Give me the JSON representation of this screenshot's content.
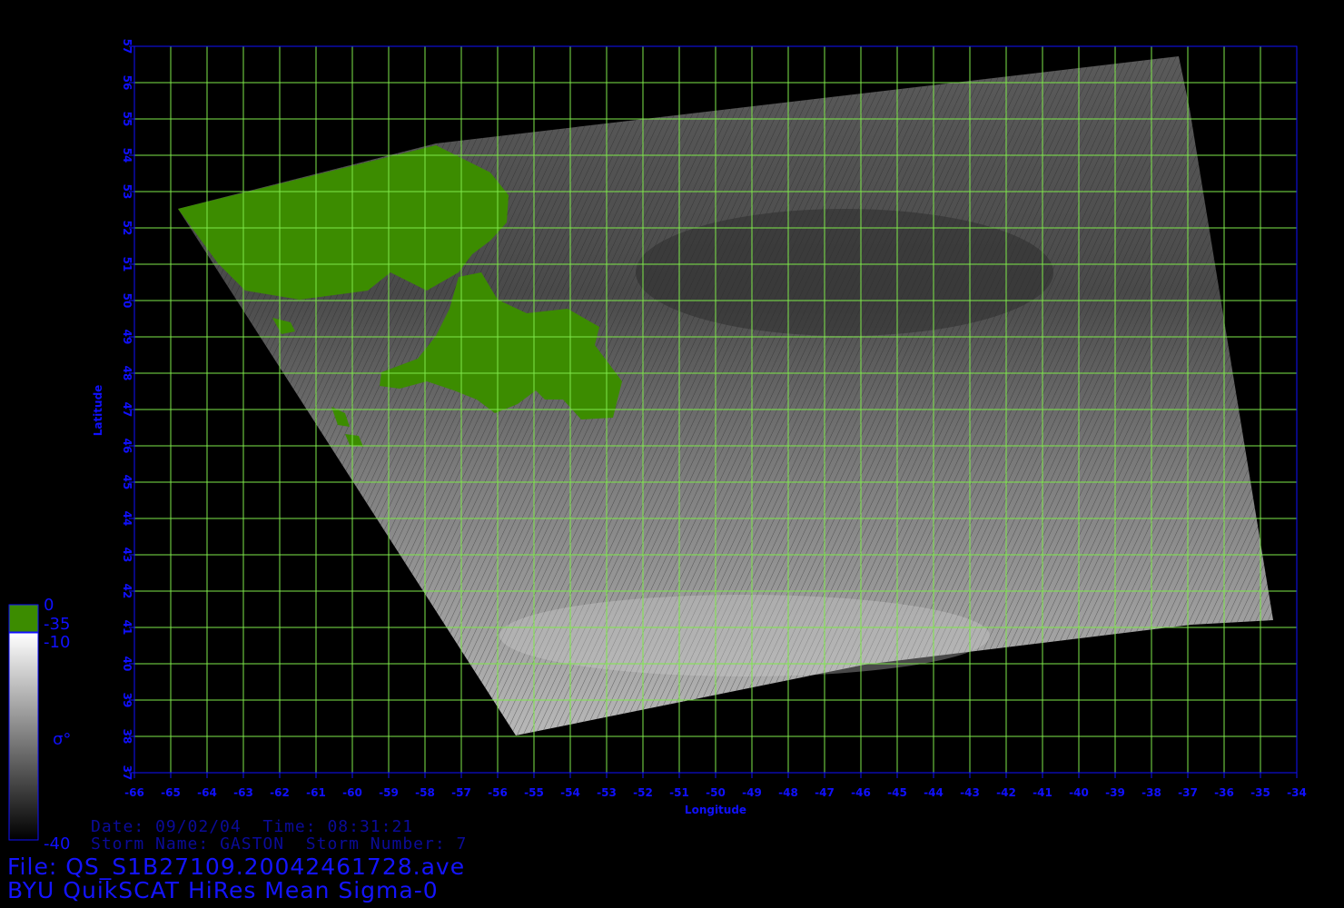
{
  "product_title": "BYU QuikSCAT HiRes Mean Sigma-0",
  "file": {
    "label": "File:",
    "name": "QS_S1B27109.20042461728.ave"
  },
  "info": {
    "date_label": "Date:",
    "date": "09/02/04",
    "time_label": "Time:",
    "time": "08:31:21",
    "storm_name_label": "Storm Name:",
    "storm_name": "GASTON",
    "storm_number_label": "Storm Number:",
    "storm_number": "7"
  },
  "axes": {
    "xlabel": "Longitude",
    "ylabel": "Latitude",
    "lon_ticks": [
      "-66",
      "-65",
      "-64",
      "-63",
      "-62",
      "-61",
      "-60",
      "-59",
      "-58",
      "-57",
      "-56",
      "-55",
      "-54",
      "-53",
      "-52",
      "-51",
      "-50",
      "-49",
      "-48",
      "-47",
      "-46",
      "-45",
      "-44",
      "-43",
      "-42",
      "-41",
      "-40",
      "-39",
      "-38",
      "-37",
      "-36",
      "-35",
      "-34"
    ],
    "lat_ticks": [
      "37",
      "38",
      "39",
      "40",
      "41",
      "42",
      "43",
      "44",
      "45",
      "46",
      "47",
      "48",
      "49",
      "50",
      "51",
      "52",
      "53",
      "54",
      "55",
      "56",
      "57"
    ],
    "lon_range": [
      -66,
      -34
    ],
    "lat_range": [
      37,
      57
    ],
    "grid": true
  },
  "colorbar": {
    "labels": [
      "0",
      "-35",
      "-10",
      "σ°",
      "-40"
    ],
    "land_color": "#3c8c00",
    "ramp_top": "#ffffff",
    "ramp_bottom": "#000000"
  },
  "colors": {
    "axis": "#1010ff",
    "grid": "#7ee84a",
    "text": "#1414ff",
    "background": "#000000"
  }
}
